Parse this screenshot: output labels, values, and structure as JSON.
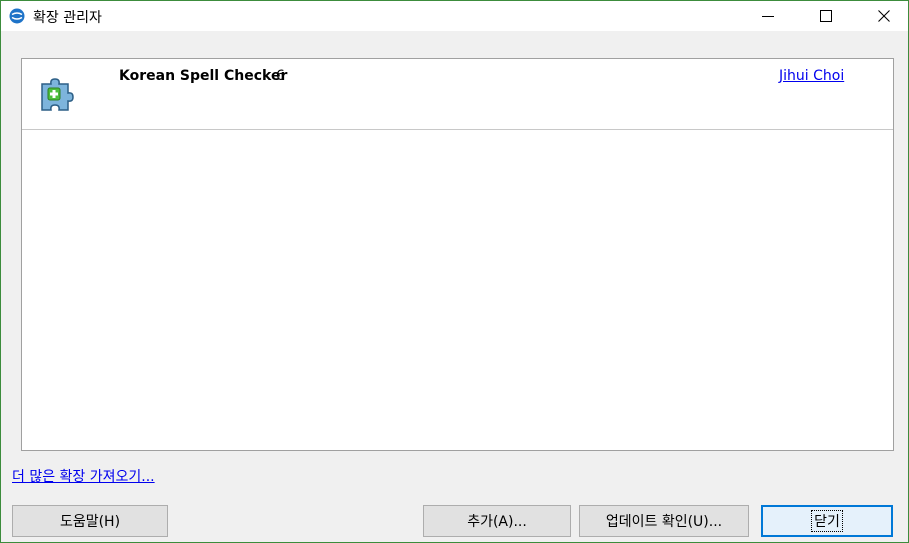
{
  "window": {
    "title": "확장 관리자",
    "controls": {
      "minimize": "—",
      "maximize": "☐",
      "close": "✕"
    }
  },
  "extensions": [
    {
      "name": "Korean Spell Checker",
      "version": "6",
      "author": "Jihui Choi",
      "icon": "puzzle-piece-icon"
    }
  ],
  "links": {
    "more_extensions": "더 많은 확장 가져오기..."
  },
  "buttons": {
    "help": "도움말(H)",
    "add": "추가(A)...",
    "check_updates": "업데이트 확인(U)...",
    "close": "닫기"
  },
  "colors": {
    "link": "#0000ee",
    "window_border": "#3c8c3c",
    "focus_border": "#0078d7"
  }
}
